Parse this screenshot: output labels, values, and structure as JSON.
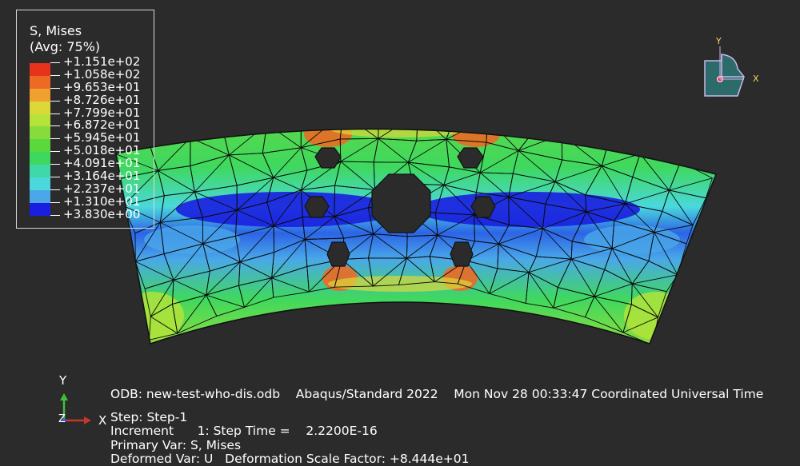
{
  "legend": {
    "title": "S, Mises",
    "subtitle": "(Avg: 75%)",
    "levels": [
      {
        "label": "+1.151e+02",
        "color": "#e8331c"
      },
      {
        "label": "+1.058e+02",
        "color": "#ec6a24"
      },
      {
        "label": "+9.653e+01",
        "color": "#f0a02e"
      },
      {
        "label": "+8.726e+01",
        "color": "#dcd83a"
      },
      {
        "label": "+7.799e+01",
        "color": "#b6e33a"
      },
      {
        "label": "+6.872e+01",
        "color": "#86dc3a"
      },
      {
        "label": "+5.945e+01",
        "color": "#5ad83c"
      },
      {
        "label": "+5.018e+01",
        "color": "#3fd85e"
      },
      {
        "label": "+4.091e+01",
        "color": "#40d8a8"
      },
      {
        "label": "+3.164e+01",
        "color": "#4ad8dc"
      },
      {
        "label": "+2.237e+01",
        "color": "#4aa8e8"
      },
      {
        "label": "+1.310e+01",
        "color": "#2c64e6"
      },
      {
        "label": "+3.830e+00",
        "color": "#1a1ee0"
      }
    ]
  },
  "info": {
    "odb": "ODB: new-test-who-dis.odb    Abaqus/Standard 2022    Mon Nov 28 00:33:47 Coordinated Universal Time",
    "step": "Step: Step-1",
    "increment": "Increment      1: Step Time =    2.2200E-16",
    "primary_var": "Primary Var: S, Mises",
    "deformed_var": "Deformed Var: U   Deformation Scale Factor: +8.444e+01"
  },
  "view_cube": {
    "x_label": "X",
    "y_label": "Y"
  },
  "triad": {
    "x_label": "X",
    "y_label": "Y",
    "z_label": "Z"
  }
}
